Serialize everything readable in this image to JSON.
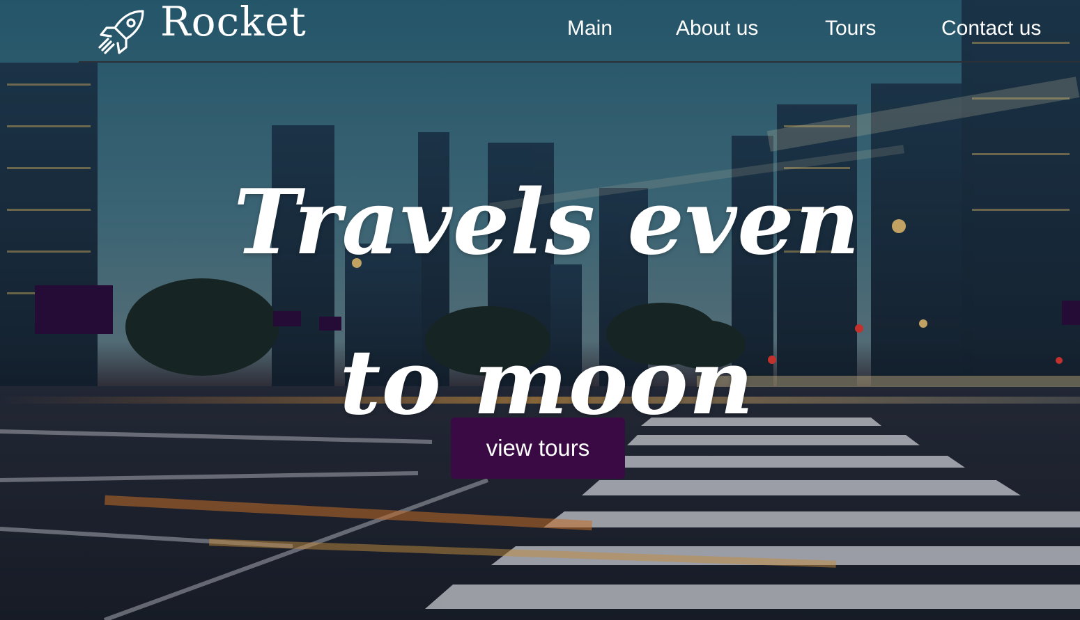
{
  "brand": {
    "name": "Rocket",
    "icon": "rocket-icon"
  },
  "nav": {
    "items": [
      {
        "label": "Main"
      },
      {
        "label": "About us"
      },
      {
        "label": "Tours"
      },
      {
        "label": "Contact us"
      }
    ]
  },
  "hero": {
    "title": "Travels even to moon",
    "button_label": "view tours"
  },
  "colors": {
    "button_bg": "#3a0a44",
    "text": "#ffffff",
    "sky_top": "#2f6f86",
    "sky_mid": "#4a7f92"
  }
}
